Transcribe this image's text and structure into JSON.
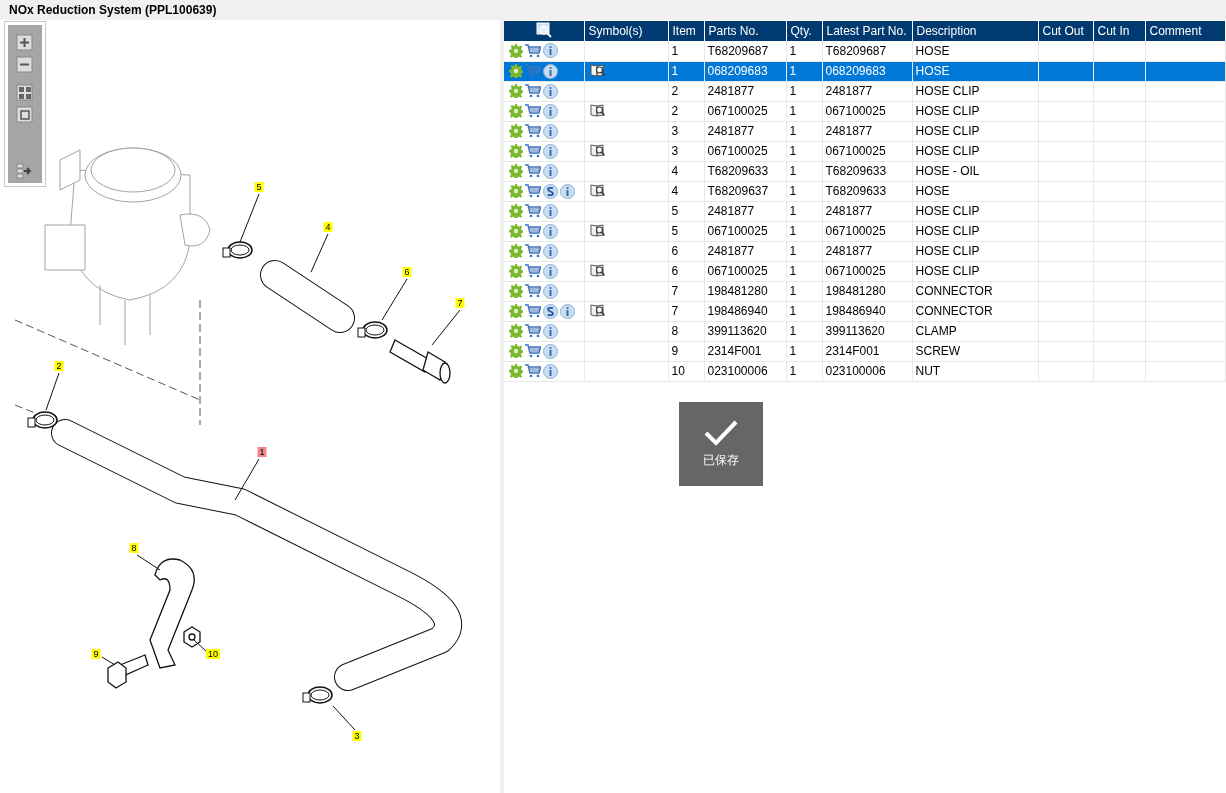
{
  "title": "NOx Reduction System (PPL100639)",
  "columns": [
    "Symbol(s)",
    "Item",
    "Parts No.",
    "Qty.",
    "Latest Part No.",
    "Description",
    "Cut Out",
    "Cut In",
    "Comment"
  ],
  "rows": [
    {
      "item": "1",
      "parts_no": "T68209687",
      "qty": "1",
      "latest": "T68209687",
      "description": "HOSE",
      "superseded": false,
      "symbol": false,
      "selected": false
    },
    {
      "item": "1",
      "parts_no": "068209683",
      "qty": "1",
      "latest": "068209683",
      "description": "HOSE",
      "superseded": false,
      "symbol": true,
      "selected": true
    },
    {
      "item": "2",
      "parts_no": "2481877",
      "qty": "1",
      "latest": "2481877",
      "description": "HOSE CLIP",
      "superseded": false,
      "symbol": false,
      "selected": false
    },
    {
      "item": "2",
      "parts_no": "067100025",
      "qty": "1",
      "latest": "067100025",
      "description": "HOSE CLIP",
      "superseded": false,
      "symbol": true,
      "selected": false
    },
    {
      "item": "3",
      "parts_no": "2481877",
      "qty": "1",
      "latest": "2481877",
      "description": "HOSE CLIP",
      "superseded": false,
      "symbol": false,
      "selected": false
    },
    {
      "item": "3",
      "parts_no": "067100025",
      "qty": "1",
      "latest": "067100025",
      "description": "HOSE CLIP",
      "superseded": false,
      "symbol": true,
      "selected": false
    },
    {
      "item": "4",
      "parts_no": "T68209633",
      "qty": "1",
      "latest": "T68209633",
      "description": "HOSE - OIL",
      "superseded": false,
      "symbol": false,
      "selected": false
    },
    {
      "item": "4",
      "parts_no": "T68209637",
      "qty": "1",
      "latest": "T68209633",
      "description": "HOSE",
      "superseded": true,
      "symbol": true,
      "selected": false
    },
    {
      "item": "5",
      "parts_no": "2481877",
      "qty": "1",
      "latest": "2481877",
      "description": "HOSE CLIP",
      "superseded": false,
      "symbol": false,
      "selected": false
    },
    {
      "item": "5",
      "parts_no": "067100025",
      "qty": "1",
      "latest": "067100025",
      "description": "HOSE CLIP",
      "superseded": false,
      "symbol": true,
      "selected": false
    },
    {
      "item": "6",
      "parts_no": "2481877",
      "qty": "1",
      "latest": "2481877",
      "description": "HOSE CLIP",
      "superseded": false,
      "symbol": false,
      "selected": false
    },
    {
      "item": "6",
      "parts_no": "067100025",
      "qty": "1",
      "latest": "067100025",
      "description": "HOSE CLIP",
      "superseded": false,
      "symbol": true,
      "selected": false
    },
    {
      "item": "7",
      "parts_no": "198481280",
      "qty": "1",
      "latest": "198481280",
      "description": "CONNECTOR",
      "superseded": false,
      "symbol": false,
      "selected": false
    },
    {
      "item": "7",
      "parts_no": "198486940",
      "qty": "1",
      "latest": "198486940",
      "description": "CONNECTOR",
      "superseded": true,
      "symbol": true,
      "selected": false
    },
    {
      "item": "8",
      "parts_no": "399113620",
      "qty": "1",
      "latest": "399113620",
      "description": "CLAMP",
      "superseded": false,
      "symbol": false,
      "selected": false
    },
    {
      "item": "9",
      "parts_no": "2314F001",
      "qty": "1",
      "latest": "2314F001",
      "description": "SCREW",
      "superseded": false,
      "symbol": false,
      "selected": false
    },
    {
      "item": "10",
      "parts_no": "023100006",
      "qty": "1",
      "latest": "023100006",
      "description": "NUT",
      "superseded": false,
      "symbol": false,
      "selected": false
    }
  ],
  "callouts": [
    {
      "label": "5",
      "selected": false
    },
    {
      "label": "4",
      "selected": false
    },
    {
      "label": "6",
      "selected": false
    },
    {
      "label": "7",
      "selected": false
    },
    {
      "label": "2",
      "selected": false
    },
    {
      "label": "1",
      "selected": true
    },
    {
      "label": "8",
      "selected": false
    },
    {
      "label": "9",
      "selected": false
    },
    {
      "label": "10",
      "selected": false
    },
    {
      "label": "3",
      "selected": false
    }
  ],
  "toast": {
    "message": "已保存"
  }
}
